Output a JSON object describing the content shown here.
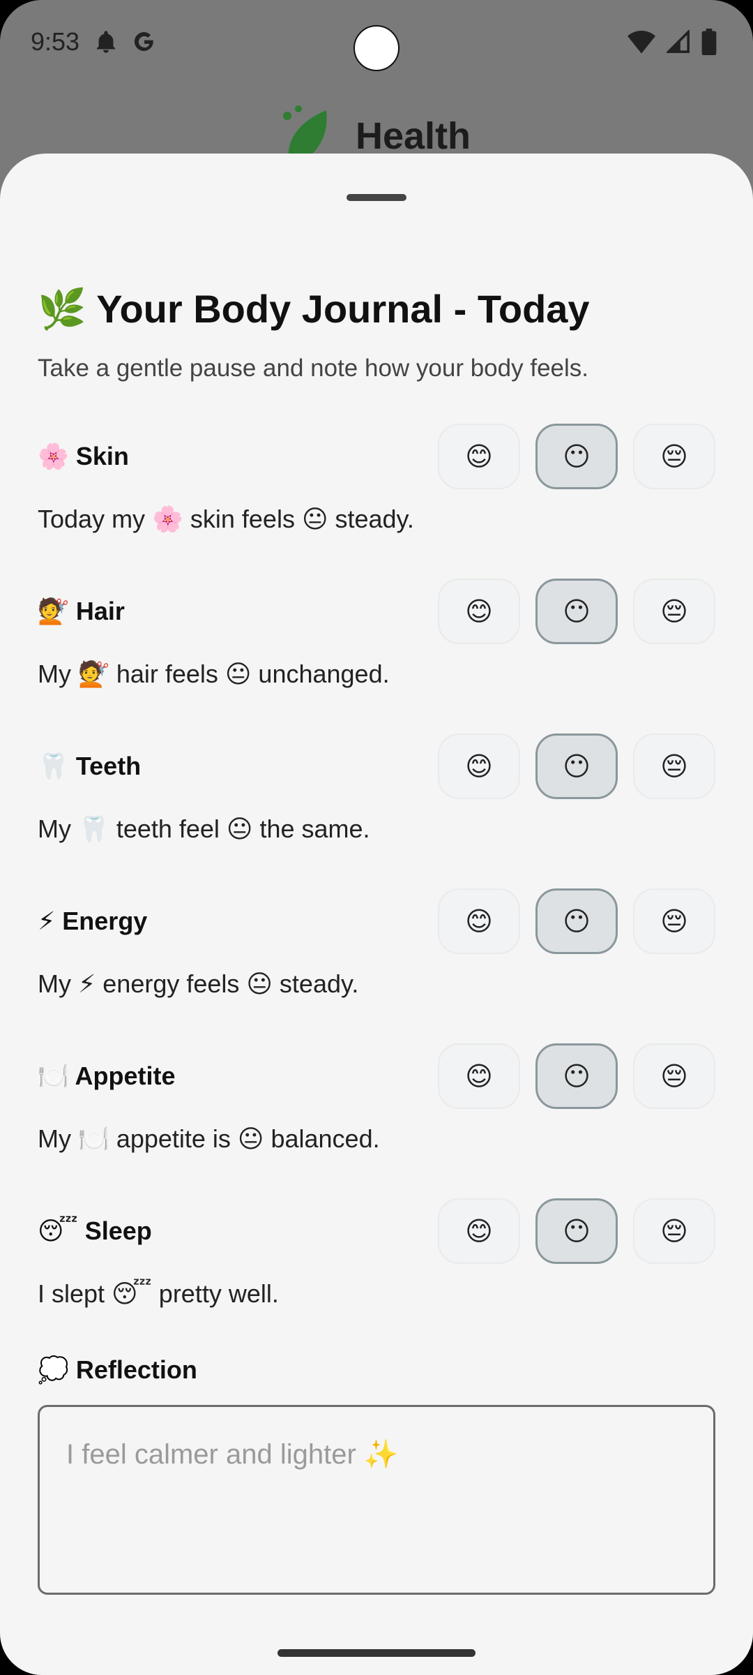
{
  "status_bar": {
    "time": "9:53",
    "left_icons": [
      "bell-icon",
      "google-icon"
    ],
    "right_icons": [
      "wifi-icon",
      "signal-icon",
      "battery-icon"
    ]
  },
  "background_app": {
    "title": "Health"
  },
  "sheet": {
    "title": "🌿 Your Body Journal - Today",
    "subtitle": "Take a gentle pause and note how your body feels.",
    "mood_options": [
      "😊",
      "😶",
      "😔"
    ],
    "entries": [
      {
        "label": "🌸 Skin",
        "selected_mood": 1,
        "text": "Today my 🌸 skin feels 😐 steady."
      },
      {
        "label": "💇 Hair",
        "selected_mood": 1,
        "text": "My 💇 hair feels 😐 unchanged."
      },
      {
        "label": "🦷 Teeth",
        "selected_mood": 1,
        "text": "My 🦷 teeth feel 😐 the same."
      },
      {
        "label": "⚡ Energy",
        "selected_mood": 1,
        "text": "My ⚡ energy feels 😐 steady."
      },
      {
        "label": "🍽️ Appetite",
        "selected_mood": 1,
        "text": "My 🍽️ appetite is 😐 balanced."
      },
      {
        "label": "😴 Sleep",
        "selected_mood": 1,
        "text": "I slept 😴 pretty well."
      }
    ],
    "reflection": {
      "label": "💭 Reflection",
      "placeholder": "I feel calmer and lighter ✨",
      "value": ""
    }
  },
  "colors": {
    "sheet_bg": "#f5f5f5",
    "scrim": "#7a7a7a",
    "selected_mood_bg": "#dde1e3",
    "selected_mood_border": "#8a979c",
    "leaf_green": "#2e7d32"
  }
}
